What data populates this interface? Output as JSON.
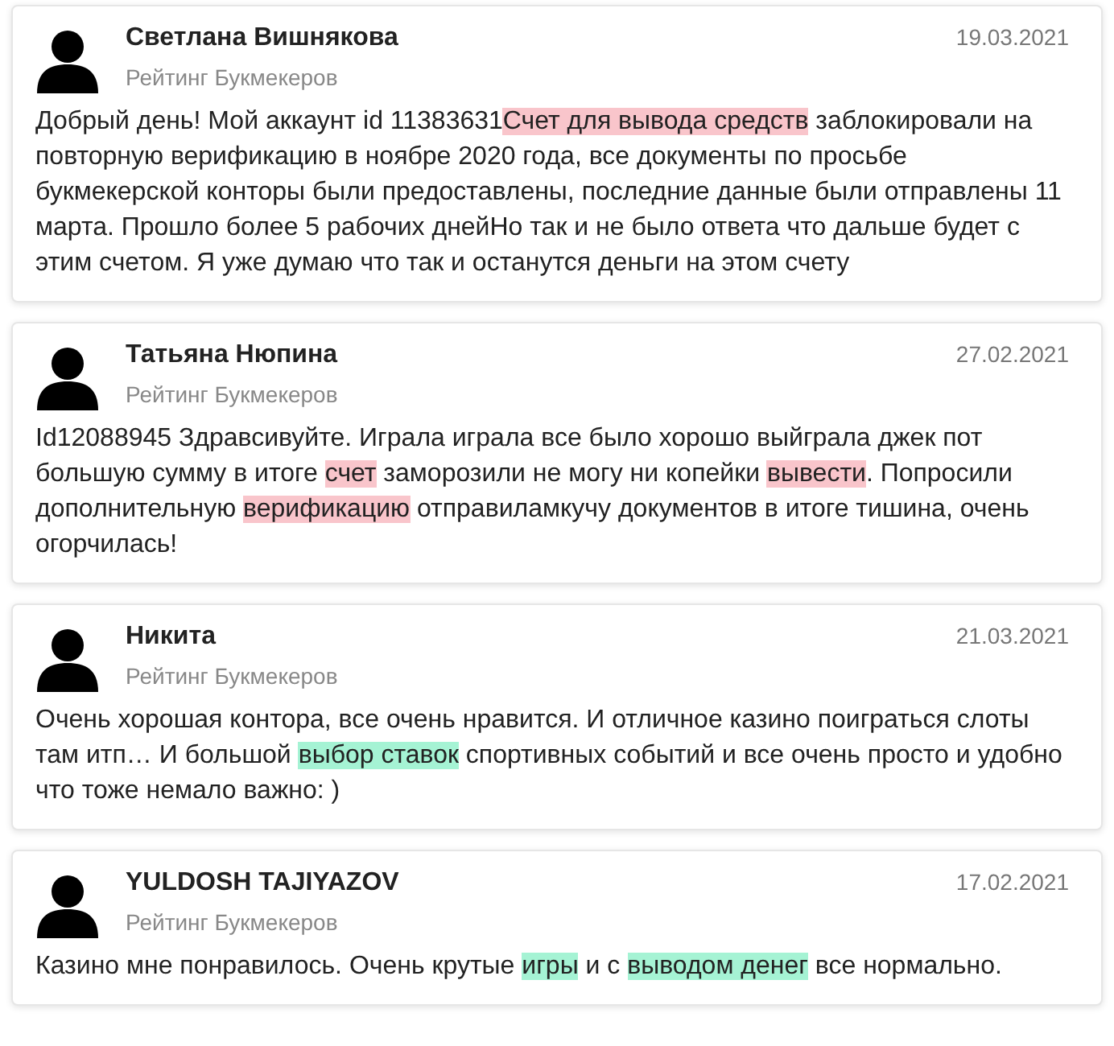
{
  "reviews": [
    {
      "author": "Светлана Вишнякова",
      "date": "19.03.2021",
      "source": "Рейтинг Букмекеров",
      "body": [
        {
          "text": "Добрый день! Мой аккаунт id 11383631"
        },
        {
          "text": "Счет для вывода средств",
          "color": "#f9c5cb"
        },
        {
          "text": " заблокировали на повторную верификацию в ноябре 2020 года, все документы по просьбе букмекерской конторы были предоставлены, последние данные были отправлены 11 марта. Прошло более 5 рабочих днейНо так и не было ответа что дальше будет с этим счетом. Я уже думаю что так и останутся деньги на этом счету"
        }
      ]
    },
    {
      "author": "Татьяна Нюпина",
      "date": "27.02.2021",
      "source": "Рейтинг Букмекеров",
      "body": [
        {
          "text": "Id12088945 Здравсивуйте. Играла играла все было хорошо выйграла джек пот большую сумму в итоге "
        },
        {
          "text": "счет",
          "color": "#f9c5cb"
        },
        {
          "text": " заморозили не могу ни копейки "
        },
        {
          "text": "вывести",
          "color": "#f9c5cb"
        },
        {
          "text": ". Попросили дополнительную "
        },
        {
          "text": "верификацию",
          "color": "#f9c5cb"
        },
        {
          "text": " отправиламкучу документов в итоге тишина, очень огорчилась!"
        }
      ]
    },
    {
      "author": "Никита",
      "date": "21.03.2021",
      "source": "Рейтинг Букмекеров",
      "body": [
        {
          "text": "Очень хорошая контора, все очень нравится. И отличное казино поиграться слоты там итп… И большой "
        },
        {
          "text": "выбор ставок",
          "color": "#a5f3d4"
        },
        {
          "text": " спортивных событий и все очень просто и удобно что тоже немало важно: )"
        }
      ]
    },
    {
      "author": "YULDOSH TAJIYAZOV",
      "date": "17.02.2021",
      "source": "Рейтинг Букмекеров",
      "body": [
        {
          "text": "Казино мне понравилось. Очень крутые "
        },
        {
          "text": "игры",
          "color": "#a5f3d4"
        },
        {
          "text": " и с "
        },
        {
          "text": "выводом денег",
          "color": "#a5f3d4"
        },
        {
          "text": " все нормально."
        }
      ]
    }
  ]
}
